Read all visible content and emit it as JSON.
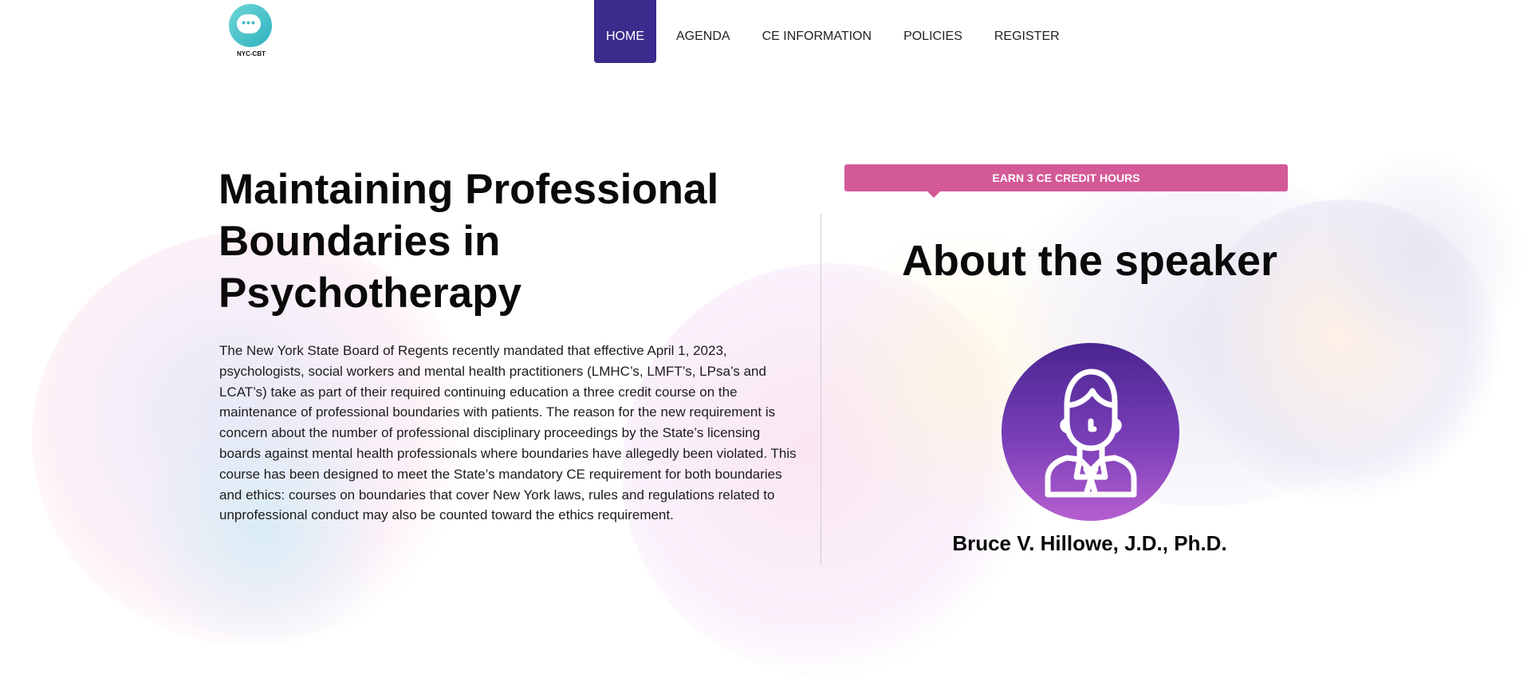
{
  "header": {
    "logo_text": "NYC-CBT",
    "logo_dots": "•••",
    "nav": [
      {
        "label": "HOME",
        "active": true
      },
      {
        "label": "AGENDA",
        "active": false
      },
      {
        "label": "CE INFORMATION",
        "active": false
      },
      {
        "label": "POLICIES",
        "active": false
      },
      {
        "label": "REGISTER",
        "active": false
      }
    ]
  },
  "main": {
    "title": "Maintaining Professional Boundaries in Psychotherapy",
    "body": "The New York State Board of Regents recently mandated that effective April 1, 2023, psychologists, social workers and mental health practitioners (LMHC’s, LMFT’s, LPsa’s and LCAT’s) take as part of their required continuing education a three credit course on the maintenance of professional boundaries with patients. The reason for the new requirement is concern about the number of professional disciplinary proceedings by the State’s licensing boards against mental health professionals where boundaries have allegedly been violated. This course has been designed to meet the State’s mandatory CE requirement for both boundaries and ethics: courses on boundaries that cover New York laws, rules and regulations related to unprofessional conduct may also be counted toward the ethics requirement."
  },
  "sidebar": {
    "banner": "EARN 3 CE CREDIT HOURS",
    "heading": "About the speaker",
    "speaker_name": "Bruce V. Hillowe, J.D., Ph.D.",
    "avatar_icon": "person-with-tie-icon"
  },
  "colors": {
    "nav_active": "#3c2a8c",
    "banner": "#d35a97",
    "avatar_top": "#4a2590",
    "avatar_bottom": "#b55fd0",
    "logo": "#2fb2bf"
  }
}
